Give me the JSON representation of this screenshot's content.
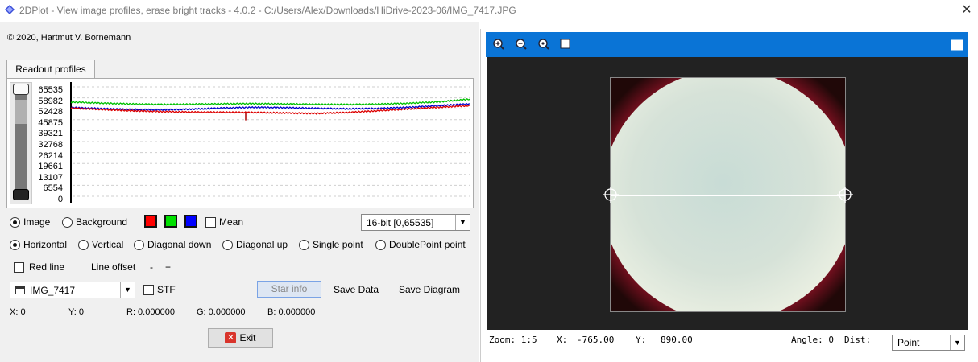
{
  "window": {
    "title": "2DPlot - View image profiles, erase bright tracks - 4.0.2 - C:/Users/Alex/Downloads/HiDrive-2023-06/IMG_7417.JPG",
    "close_glyph": "✕"
  },
  "left": {
    "copyright": "© 2020, Hartmut V. Bornemann",
    "tab_label": "Readout profiles",
    "y_ticks": [
      "65535",
      "58982",
      "52428",
      "45875",
      "39321",
      "32768",
      "26214",
      "19661",
      "13107",
      "6554",
      "0"
    ],
    "source": {
      "image_label": "Image",
      "background_label": "Background",
      "mean_label": "Mean",
      "selected": "Image"
    },
    "channel_colors": {
      "red": "#ff0000",
      "green": "#00e000",
      "blue": "#0000ff"
    },
    "bitdepth": "16-bit [0,65535]",
    "directions": [
      "Horizontal",
      "Vertical",
      "Diagonal down",
      "Diagonal up",
      "Single point",
      "DoublePoint point"
    ],
    "direction_selected": "Horizontal",
    "red_line_label": "Red line",
    "line_offset_label": "Line offset",
    "minus": "-",
    "plus": "+",
    "image_select": "IMG_7417",
    "stf_label": "STF",
    "star_info": "Star info",
    "save_data": "Save Data",
    "save_diagram": "Save Diagram",
    "readout": {
      "x": "X: 0",
      "y": "Y: 0",
      "r": "R: 0.000000",
      "g": "G: 0.000000",
      "b": "B: 0.000000"
    },
    "exit": "Exit"
  },
  "right": {
    "toolbar_icons": [
      "zoom-in-icon",
      "zoom-out-icon",
      "zoom-fit-icon",
      "stop-icon",
      "window-icon"
    ],
    "status": {
      "zoom": "Zoom: 1:5",
      "x_label": "X:",
      "x_value": "-765.00",
      "y_label": "Y:",
      "y_value": "890.00",
      "angle": "Angle: 0",
      "dist": "Dist:",
      "point_select": "Point"
    },
    "toolbar_color": "#0a74d6"
  },
  "chart_data": {
    "type": "line",
    "ylim": [
      0,
      65535
    ],
    "y_ticks": [
      65535,
      58982,
      52428,
      45875,
      39321,
      32768,
      26214,
      19661,
      13107,
      6554,
      0
    ],
    "series": [
      {
        "color": "#00c000",
        "values": [
          56500,
          55800,
          55300,
          55000,
          55200,
          55400,
          55500,
          55300,
          55100,
          55000,
          55200,
          55700,
          56600,
          58200
        ]
      },
      {
        "color": "#0000cc",
        "values": [
          53200,
          52500,
          52000,
          51800,
          52200,
          52900,
          53300,
          53100,
          52700,
          52400,
          52600,
          53300,
          54300,
          55400
        ]
      },
      {
        "color": "#dd0000",
        "values": [
          52800,
          52000,
          51200,
          50700,
          50400,
          50300,
          50200,
          49900,
          49600,
          50200,
          51200,
          52300,
          53300,
          54300
        ]
      }
    ]
  }
}
